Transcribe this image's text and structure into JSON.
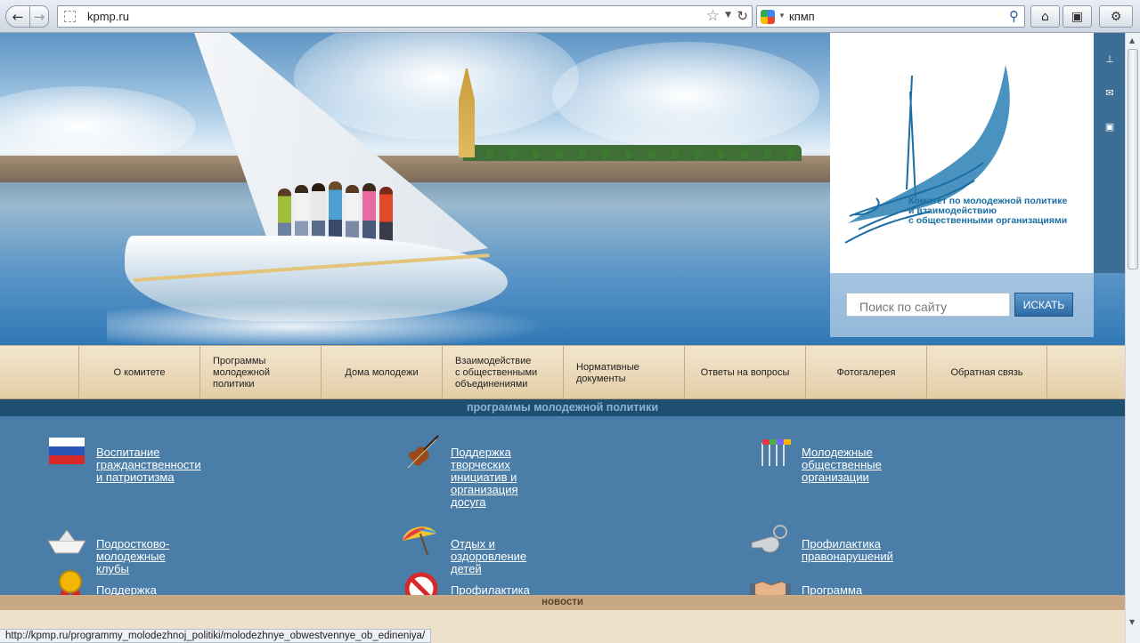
{
  "browser": {
    "url": "kpmp.ru",
    "search_query": "кпмп",
    "status_url": "http://kpmp.ru/programmy_molodezhnoj_politiki/molodezhnye_obwestvennye_ob_edineniya/"
  },
  "header": {
    "logo_text": "Комитет по молодежной политике\nи взаимодействию\nс общественными организациями",
    "search_placeholder": "Поиск по сайту",
    "search_button": "ИСКАТЬ"
  },
  "nav": {
    "items": [
      {
        "label": "О комитете"
      },
      {
        "label": "Программы\nмолодежной\nполитики"
      },
      {
        "label": "Дома молодежи"
      },
      {
        "label": "Взаимодействие\nс общественными\nобъединениями"
      },
      {
        "label": "Нормативные\nдокументы"
      },
      {
        "label": "Ответы на вопросы"
      },
      {
        "label": "Фотогалерея"
      },
      {
        "label": "Обратная связь"
      }
    ]
  },
  "programs": {
    "heading": "программы молодежной политики",
    "items": [
      {
        "label": "Воспитание гражданственности и патриотизма",
        "icon": "russian-flag-icon"
      },
      {
        "label": "Поддержка творческих инициатив и\nорганизация досуга",
        "icon": "violin-icon"
      },
      {
        "label": "Молодежные общественные организации",
        "icon": "flags-icon"
      },
      {
        "label": "Подростково-молодежные клубы",
        "icon": "paper-boat-icon"
      },
      {
        "label": "Отдых и оздоровление детей",
        "icon": "beach-umbrella-icon"
      },
      {
        "label": "Профилактика правонарушений",
        "icon": "whistle-icon"
      },
      {
        "label": "Поддержка талантливой молодежи",
        "icon": "medal-icon"
      },
      {
        "label": "Профилактика наркозависимости",
        "icon": "prohibition-icon"
      },
      {
        "label": "Программа «Толерантность»",
        "icon": "handshake-icon"
      }
    ]
  },
  "news": {
    "heading": "новости"
  },
  "colors": {
    "primary_blue": "#4a7ea8",
    "dark_blue": "#1e4f73",
    "nav_beige": "#e3cda7",
    "logo_blue": "#1a6ea3"
  }
}
